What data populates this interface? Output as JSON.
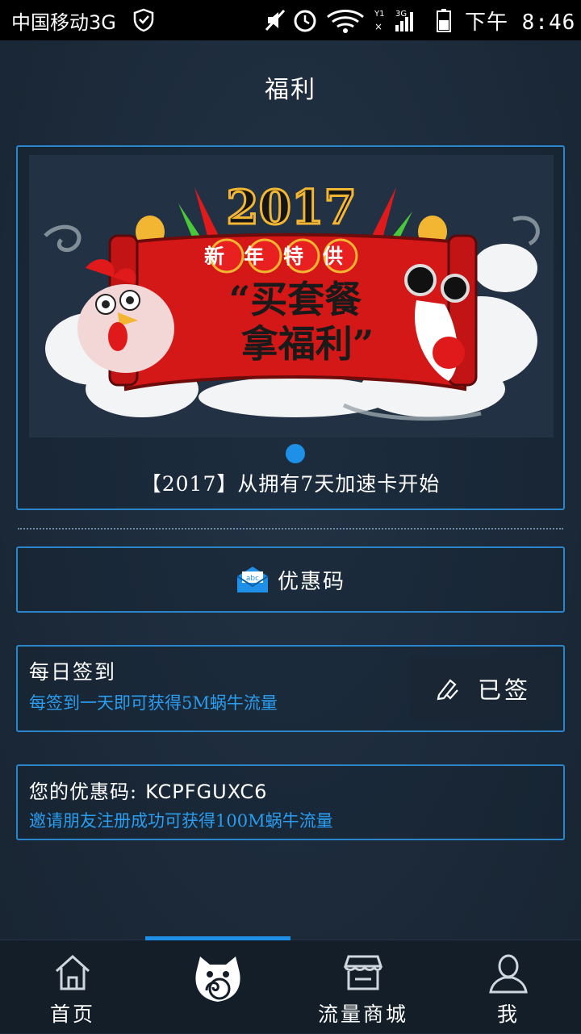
{
  "status_bar": {
    "carrier": "中国移动3G",
    "time": "下午 8:46"
  },
  "page": {
    "title": "福利"
  },
  "banner": {
    "year_text": "2017",
    "ribbon_text": "新年特供",
    "slogan_line1": "“买套餐",
    "slogan_line2": "拿福利”",
    "caption": "【2017】从拥有7天加速卡开始"
  },
  "coupon": {
    "label": "优惠码",
    "icon_text": "abc"
  },
  "checkin": {
    "title": "每日签到",
    "description": "每签到一天即可获得5M蜗牛流量",
    "button_label": "已签"
  },
  "invite": {
    "label": "您的优惠码:",
    "code": "KCPFGUXC6",
    "description": "邀请朋友注册成功可获得100M蜗牛流量"
  },
  "tabs": [
    {
      "label": "首页",
      "icon": "home-icon"
    },
    {
      "label": "",
      "icon": "snail-cat-icon"
    },
    {
      "label": "流量商城",
      "icon": "shop-icon"
    },
    {
      "label": "我",
      "icon": "user-icon"
    }
  ],
  "colors": {
    "accent": "#1e90e8",
    "panel_border": "#2b86c9",
    "desc_text": "#2a9df0",
    "background": "#1b2838"
  }
}
